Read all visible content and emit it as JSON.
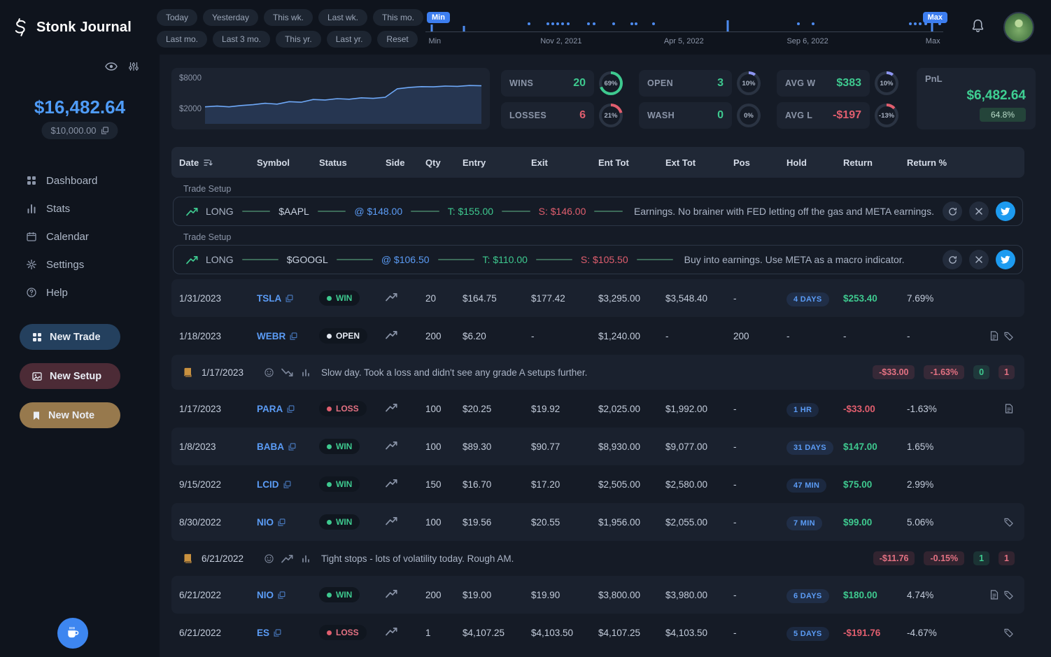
{
  "app": {
    "name": "Stonk Journal"
  },
  "topbar": {
    "quick_filters_row1": [
      "Today",
      "Yesterday",
      "This wk.",
      "Last wk.",
      "This mo."
    ],
    "quick_filters_row2": [
      "Last mo.",
      "Last 3 mo.",
      "This yr.",
      "Last yr.",
      "Reset"
    ],
    "timeline": {
      "min_badge": "Min",
      "max_badge": "Max",
      "axis_labels": [
        "Min",
        "Nov 2, 2021",
        "Apr 5, 2022",
        "Sep 6, 2022",
        "Max"
      ],
      "axis_positions_pct": [
        1.8,
        26.2,
        49.9,
        73.8,
        98.0
      ],
      "dot_positions_pct": [
        20,
        23.7,
        24.6,
        25.6,
        26.5,
        27.5,
        31.5,
        32.5,
        36.3,
        39.8,
        40.7,
        44,
        72,
        74.8,
        93.6,
        94.6,
        95.6,
        96.6,
        99.3
      ],
      "bars": [
        {
          "pct": 1.2,
          "h": 10
        },
        {
          "pct": 7.4,
          "h": 8
        },
        {
          "pct": 58.4,
          "h": 16
        },
        {
          "pct": 97.9,
          "h": 13
        }
      ]
    }
  },
  "sidebar": {
    "balance": "$16,482.64",
    "starting_balance": "$10,000.00",
    "menu": [
      {
        "label": "Dashboard",
        "icon": "grid-icon"
      },
      {
        "label": "Stats",
        "icon": "stats-icon"
      },
      {
        "label": "Calendar",
        "icon": "calendar-icon"
      },
      {
        "label": "Settings",
        "icon": "gear-icon"
      },
      {
        "label": "Help",
        "icon": "help-icon"
      }
    ],
    "actions": [
      {
        "label": "New Trade",
        "icon": "grid-icon"
      },
      {
        "label": "New Setup",
        "icon": "image-icon"
      },
      {
        "label": "New Note",
        "icon": "bookmark-icon"
      }
    ]
  },
  "stats": {
    "wins": {
      "label": "WINS",
      "value": "20",
      "gauge": "69%",
      "gauge_pct": 69,
      "gauge_color": "#3ec98f"
    },
    "losses": {
      "label": "LOSSES",
      "value": "6",
      "gauge": "21%",
      "gauge_pct": 21,
      "gauge_color": "#e05e6e"
    },
    "open": {
      "label": "OPEN",
      "value": "3",
      "gauge": "10%",
      "gauge_pct": 10,
      "gauge_color": "#8d96f2"
    },
    "wash": {
      "label": "WASH",
      "value": "0",
      "gauge": "0%",
      "gauge_pct": 0,
      "gauge_color": "#8d96f2"
    },
    "avg_w": {
      "label": "AVG W",
      "value": "$383",
      "gauge": "10%",
      "gauge_pct": 10,
      "gauge_color": "#8d96f2"
    },
    "avg_l": {
      "label": "AVG L",
      "value": "-$197",
      "gauge": "-13%",
      "gauge_pct": 13,
      "gauge_color": "#e05e6e"
    },
    "pnl": {
      "label": "PnL",
      "value": "$6,482.64",
      "badge": "64.8%"
    }
  },
  "chart_data": {
    "type": "area",
    "title": "Equity curve",
    "y_axis": {
      "top_label": "$8000",
      "bottom_label": "$2000",
      "top_value": 8000,
      "bottom_value": 2000
    },
    "values": [
      2800,
      2950,
      2800,
      3050,
      3200,
      3450,
      3300,
      3750,
      3650,
      4150,
      4050,
      4300,
      4200,
      4450,
      4350,
      4550,
      6100,
      6350,
      6500,
      6450,
      6600,
      6550,
      6700,
      6650
    ],
    "line_color": "#6ea8f7",
    "fill_color": "rgba(82,130,214,0.20)"
  },
  "table": {
    "headers": [
      "Date",
      "Symbol",
      "Status",
      "Side",
      "Qty",
      "Entry",
      "Exit",
      "Ent Tot",
      "Ext Tot",
      "Pos",
      "Hold",
      "Return",
      "Return %"
    ],
    "rows": [
      {
        "type": "setup",
        "title": "Trade Setup",
        "side": "LONG",
        "symbol": "$AAPL",
        "entry": "@ $148.00",
        "target": "T: $155.00",
        "stop": "S: $146.00",
        "note": "Earnings. No brainer with FED letting off the gas and META earnings."
      },
      {
        "type": "setup",
        "title": "Trade Setup",
        "side": "LONG",
        "symbol": "$GOOGL",
        "entry": "@ $106.50",
        "target": "T: $110.00",
        "stop": "S: $105.50",
        "note": "Buy into earnings. Use META as a macro indicator."
      },
      {
        "type": "trade",
        "date": "1/31/2023",
        "symbol": "TSLA",
        "status": "WIN",
        "side": "long",
        "qty": "20",
        "entry": "$164.75",
        "exit": "$177.42",
        "ent_tot": "$3,295.00",
        "ext_tot": "$3,548.40",
        "pos": "-",
        "hold": "4 DAYS",
        "return": "$253.40",
        "return_pct": "7.69%",
        "icons": []
      },
      {
        "type": "trade",
        "date": "1/18/2023",
        "symbol": "WEBR",
        "status": "OPEN",
        "side": "long",
        "qty": "200",
        "entry": "$6.20",
        "exit": "-",
        "ent_tot": "$1,240.00",
        "ext_tot": "-",
        "pos": "200",
        "hold": "-",
        "return": "-",
        "return_pct": "-",
        "icons": [
          "doc-icon",
          "tag-icon"
        ]
      },
      {
        "type": "note",
        "date": "1/17/2023",
        "trend": "down",
        "text": "Slow day. Took a loss and didn't see any grade A setups further.",
        "badges": [
          {
            "text": "-$33.00",
            "color": "red"
          },
          {
            "text": "-1.63%",
            "color": "red"
          },
          {
            "text": "0",
            "color": "green"
          },
          {
            "text": "1",
            "color": "red"
          }
        ]
      },
      {
        "type": "trade",
        "date": "1/17/2023",
        "symbol": "PARA",
        "status": "LOSS",
        "side": "long",
        "qty": "100",
        "entry": "$20.25",
        "exit": "$19.92",
        "ent_tot": "$2,025.00",
        "ext_tot": "$1,992.00",
        "pos": "-",
        "hold": "1 HR",
        "return": "-$33.00",
        "return_pct": "-1.63%",
        "icons": [
          "doc-icon"
        ]
      },
      {
        "type": "trade",
        "date": "1/8/2023",
        "symbol": "BABA",
        "status": "WIN",
        "side": "long",
        "qty": "100",
        "entry": "$89.30",
        "exit": "$90.77",
        "ent_tot": "$8,930.00",
        "ext_tot": "$9,077.00",
        "pos": "-",
        "hold": "31 DAYS",
        "return": "$147.00",
        "return_pct": "1.65%",
        "icons": []
      },
      {
        "type": "trade",
        "date": "9/15/2022",
        "symbol": "LCID",
        "status": "WIN",
        "side": "long",
        "qty": "150",
        "entry": "$16.70",
        "exit": "$17.20",
        "ent_tot": "$2,505.00",
        "ext_tot": "$2,580.00",
        "pos": "-",
        "hold": "47 MIN",
        "return": "$75.00",
        "return_pct": "2.99%",
        "icons": []
      },
      {
        "type": "trade",
        "date": "8/30/2022",
        "symbol": "NIO",
        "status": "WIN",
        "side": "long",
        "qty": "100",
        "entry": "$19.56",
        "exit": "$20.55",
        "ent_tot": "$1,956.00",
        "ext_tot": "$2,055.00",
        "pos": "-",
        "hold": "7 MIN",
        "return": "$99.00",
        "return_pct": "5.06%",
        "icons": [
          "tag-icon"
        ]
      },
      {
        "type": "note",
        "date": "6/21/2022",
        "trend": "up",
        "text": "Tight stops - lots of volatility today. Rough AM.",
        "badges": [
          {
            "text": "-$11.76",
            "color": "red"
          },
          {
            "text": "-0.15%",
            "color": "red"
          },
          {
            "text": "1",
            "color": "green"
          },
          {
            "text": "1",
            "color": "red"
          }
        ]
      },
      {
        "type": "trade",
        "date": "6/21/2022",
        "symbol": "NIO",
        "status": "WIN",
        "side": "long",
        "qty": "200",
        "entry": "$19.00",
        "exit": "$19.90",
        "ent_tot": "$3,800.00",
        "ext_tot": "$3,980.00",
        "pos": "-",
        "hold": "6 DAYS",
        "return": "$180.00",
        "return_pct": "4.74%",
        "icons": [
          "doc-icon",
          "tag-icon"
        ]
      },
      {
        "type": "trade",
        "date": "6/21/2022",
        "symbol": "ES",
        "status": "LOSS",
        "side": "long",
        "qty": "1",
        "entry": "$4,107.25",
        "exit": "$4,103.50",
        "ent_tot": "$4,107.25",
        "ext_tot": "$4,103.50",
        "pos": "-",
        "hold": "5 DAYS",
        "return": "-$191.76",
        "return_pct": "-4.67%",
        "icons": [
          "tag-icon"
        ]
      }
    ]
  }
}
